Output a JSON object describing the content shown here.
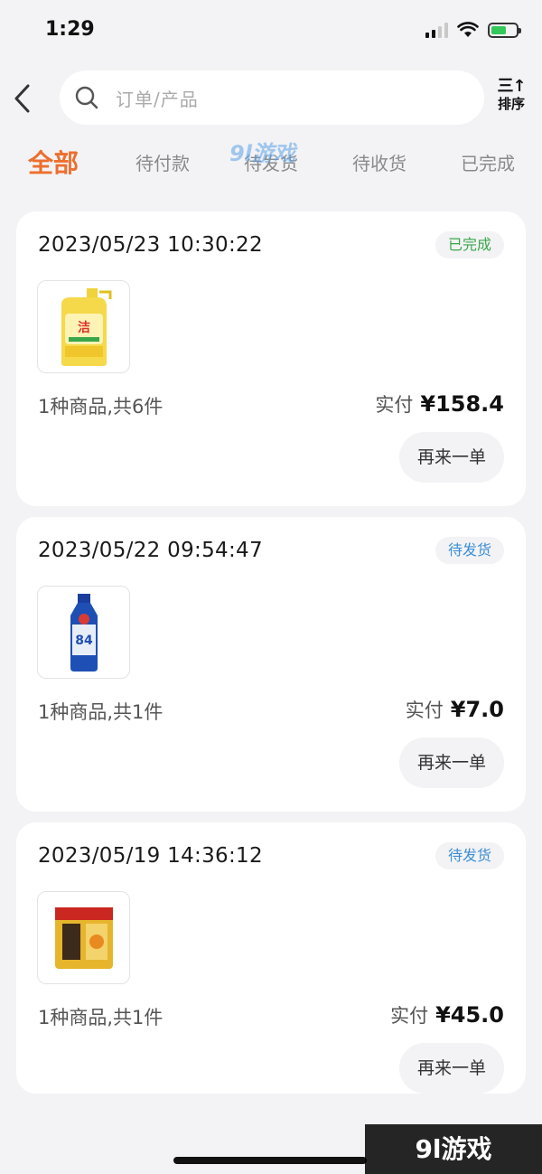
{
  "status_bar": {
    "time": "1:29"
  },
  "header": {
    "search_placeholder": "订单/产品",
    "sort_label": "排序",
    "sort_icon": "三↑"
  },
  "tabs": [
    {
      "label": "全部",
      "active": true
    },
    {
      "label": "待付款",
      "active": false
    },
    {
      "label": "待发货",
      "active": false
    },
    {
      "label": "待收货",
      "active": false
    },
    {
      "label": "已完成",
      "active": false
    }
  ],
  "orders": [
    {
      "time": "2023/05/23 10:30:22",
      "status": "已完成",
      "summary": "1种商品,共6件",
      "paid_label": "实付",
      "price": "¥158.4",
      "reorder_label": "再来一单",
      "product_icon": "dish-soap-bottle-icon"
    },
    {
      "time": "2023/05/22 09:54:47",
      "status": "待发货",
      "summary": "1种商品,共1件",
      "paid_label": "实付",
      "price": "¥7.0",
      "reorder_label": "再来一单",
      "product_icon": "disinfectant-bottle-icon"
    },
    {
      "time": "2023/05/19 14:36:12",
      "status": "待发货",
      "summary": "1种商品,共1件",
      "paid_label": "实付",
      "price": "¥45.0",
      "reorder_label": "再来一单",
      "product_icon": "rice-bag-icon"
    }
  ],
  "watermark": {
    "text": "9l游戏",
    "overlay": "9l游戏"
  },
  "colors": {
    "accent": "#ec6f2e",
    "done": "#3aa64a",
    "pending": "#3b8fd6",
    "background": "#f3f3f5"
  }
}
